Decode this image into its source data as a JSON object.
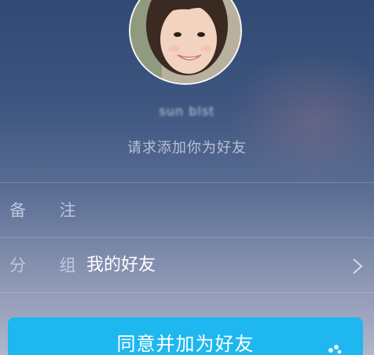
{
  "profile": {
    "username": "sun blst",
    "request_message": "请求添加你为好友"
  },
  "form": {
    "remark_label": "备 注",
    "remark_value": "",
    "group_label": "分 组",
    "group_value": "我的好友"
  },
  "actions": {
    "agree_button": "同意并加为好友"
  },
  "colors": {
    "accent": "#1fb7ef"
  }
}
